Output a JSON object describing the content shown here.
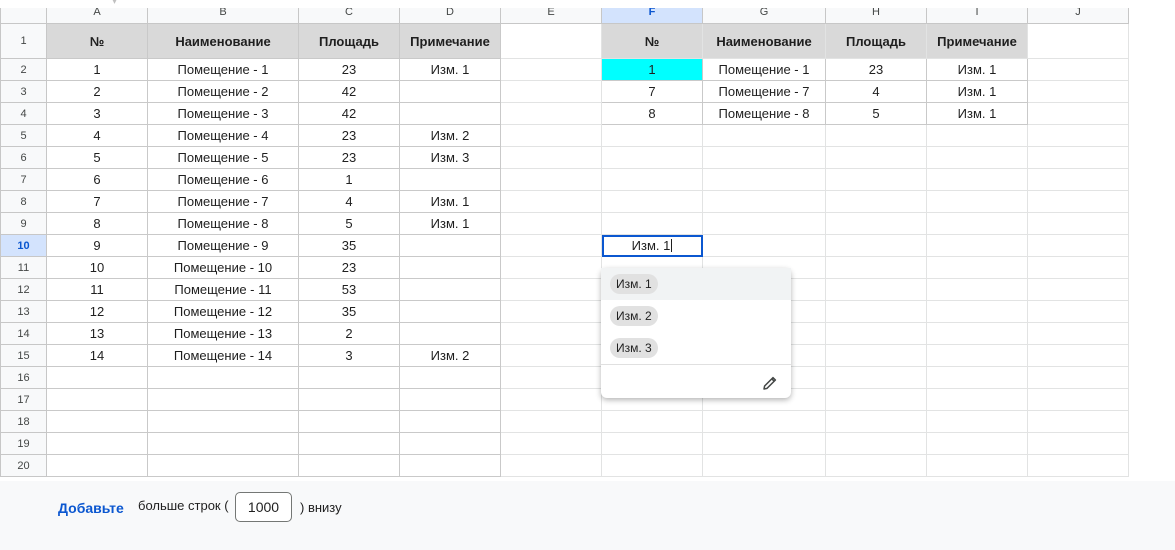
{
  "columns": [
    "A",
    "B",
    "C",
    "D",
    "E",
    "F",
    "G",
    "H",
    "I",
    "J"
  ],
  "selected_column": "F",
  "selected_row": 10,
  "table1": {
    "headers": [
      "№",
      "Наименование",
      "Площадь",
      "Примечание"
    ],
    "rows": [
      [
        "1",
        "Помещение - 1",
        "23",
        "Изм. 1"
      ],
      [
        "2",
        "Помещение - 2",
        "42",
        ""
      ],
      [
        "3",
        "Помещение - 3",
        "42",
        ""
      ],
      [
        "4",
        "Помещение - 4",
        "23",
        "Изм. 2"
      ],
      [
        "5",
        "Помещение - 5",
        "23",
        "Изм. 3"
      ],
      [
        "6",
        "Помещение - 6",
        "1",
        ""
      ],
      [
        "7",
        "Помещение - 7",
        "4",
        "Изм. 1"
      ],
      [
        "8",
        "Помещение - 8",
        "5",
        "Изм. 1"
      ],
      [
        "9",
        "Помещение - 9",
        "35",
        ""
      ],
      [
        "10",
        "Помещение - 10",
        "23",
        ""
      ],
      [
        "11",
        "Помещение - 11",
        "53",
        ""
      ],
      [
        "12",
        "Помещение - 12",
        "35",
        ""
      ],
      [
        "13",
        "Помещение - 13",
        "2",
        ""
      ],
      [
        "14",
        "Помещение - 14",
        "3",
        "Изм. 2"
      ]
    ]
  },
  "table2": {
    "headers": [
      "№",
      "Наименование",
      "Площадь",
      "Примечание"
    ],
    "rows": [
      [
        "1",
        "Помещение - 1",
        "23",
        "Изм. 1"
      ],
      [
        "7",
        "Помещение - 7",
        "4",
        "Изм. 1"
      ],
      [
        "8",
        "Помещение - 8",
        "5",
        "Изм. 1"
      ]
    ],
    "highlight_color": "#00ffff"
  },
  "active_cell": {
    "value": "Изм. 1"
  },
  "dropdown": {
    "options": [
      "Изм. 1",
      "Изм. 2",
      "Изм. 3"
    ],
    "highlighted_index": 0,
    "edit_icon": "pencil-icon"
  },
  "footer": {
    "add_label": "Добавьте",
    "more_text": "больше строк (",
    "rows_value": "1000",
    "below_text": ") внизу"
  },
  "colors": {
    "accent": "#0b57d0",
    "header_fill": "#d9d9d9",
    "selected_header": "#d3e3fd"
  }
}
